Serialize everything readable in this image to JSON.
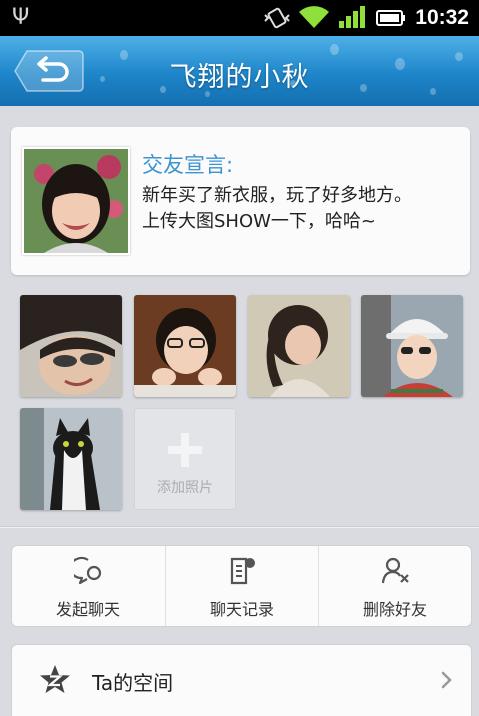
{
  "status_bar": {
    "time": "10:32",
    "icons": [
      "usb-icon",
      "vibrate-icon",
      "wifi-icon",
      "signal-icon",
      "battery-icon"
    ]
  },
  "header": {
    "title": "飞翔的小秋",
    "back_icon": "back-arrow-icon"
  },
  "profile": {
    "declaration_label": "交友宣言:",
    "declaration_lines": [
      "新年买了新衣服，玩了好多地方。",
      "上传大图SHOW一下，哈哈~"
    ]
  },
  "photos": {
    "add_label": "添加照片"
  },
  "actions": [
    {
      "label": "发起聊天",
      "icon": "chat-bubble-icon"
    },
    {
      "label": "聊天记录",
      "icon": "chat-record-icon"
    },
    {
      "label": "删除好友",
      "icon": "delete-friend-icon"
    }
  ],
  "space": {
    "label": "Ta的空间",
    "icon": "star-z-icon"
  },
  "colors": {
    "accent": "#3b93d0",
    "header_top": "#4fb0e8",
    "header_bottom": "#146fb0",
    "background": "#d9dbe0"
  }
}
